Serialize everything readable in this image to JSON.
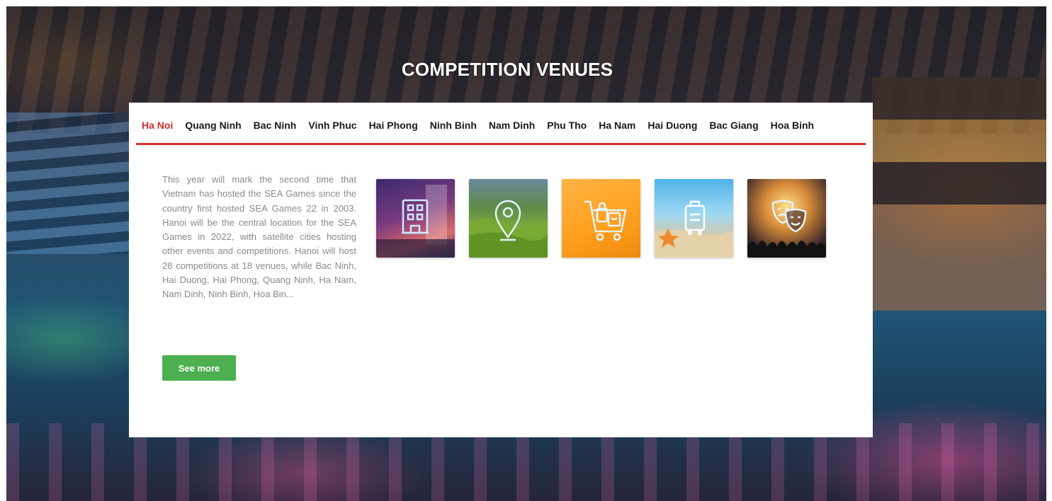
{
  "section": {
    "title": "COMPETITION VENUES"
  },
  "tabs": [
    {
      "label": "Ha Noi",
      "active": true
    },
    {
      "label": "Quang Ninh",
      "active": false
    },
    {
      "label": "Bac Ninh",
      "active": false
    },
    {
      "label": "Vinh Phuc",
      "active": false
    },
    {
      "label": "Hai Phong",
      "active": false
    },
    {
      "label": "Ninh Binh",
      "active": false
    },
    {
      "label": "Nam Dinh",
      "active": false
    },
    {
      "label": "Phu Tho",
      "active": false
    },
    {
      "label": "Ha Nam",
      "active": false
    },
    {
      "label": "Hai Duong",
      "active": false
    },
    {
      "label": "Bac Giang",
      "active": false
    },
    {
      "label": "Hoa Binh",
      "active": false
    }
  ],
  "content": {
    "description": "This year will mark the second time that Vietnam has hosted the SEA Games since the country first hosted SEA Games 22 in 2003. Hanoi will be the central location for the SEA Games in 2022, with satellite cities hosting other events and competitions. Hanoi will host 28 competitions at 18 venues, while Bac Ninh, Hai Duong, Hai Phong, Quang Ninh, Ha Nam, Nam Dinh, Ninh Binh, Hoa Bin...",
    "see_more_label": "See more"
  },
  "thumbnails": [
    {
      "icon": "hotel-icon"
    },
    {
      "icon": "location-pin-icon"
    },
    {
      "icon": "shopping-cart-icon"
    },
    {
      "icon": "luggage-icon"
    },
    {
      "icon": "theater-masks-icon"
    }
  ],
  "colors": {
    "accent_red": "#d32f2f",
    "button_green": "#4caf50",
    "body_text": "#8a8a8a"
  }
}
